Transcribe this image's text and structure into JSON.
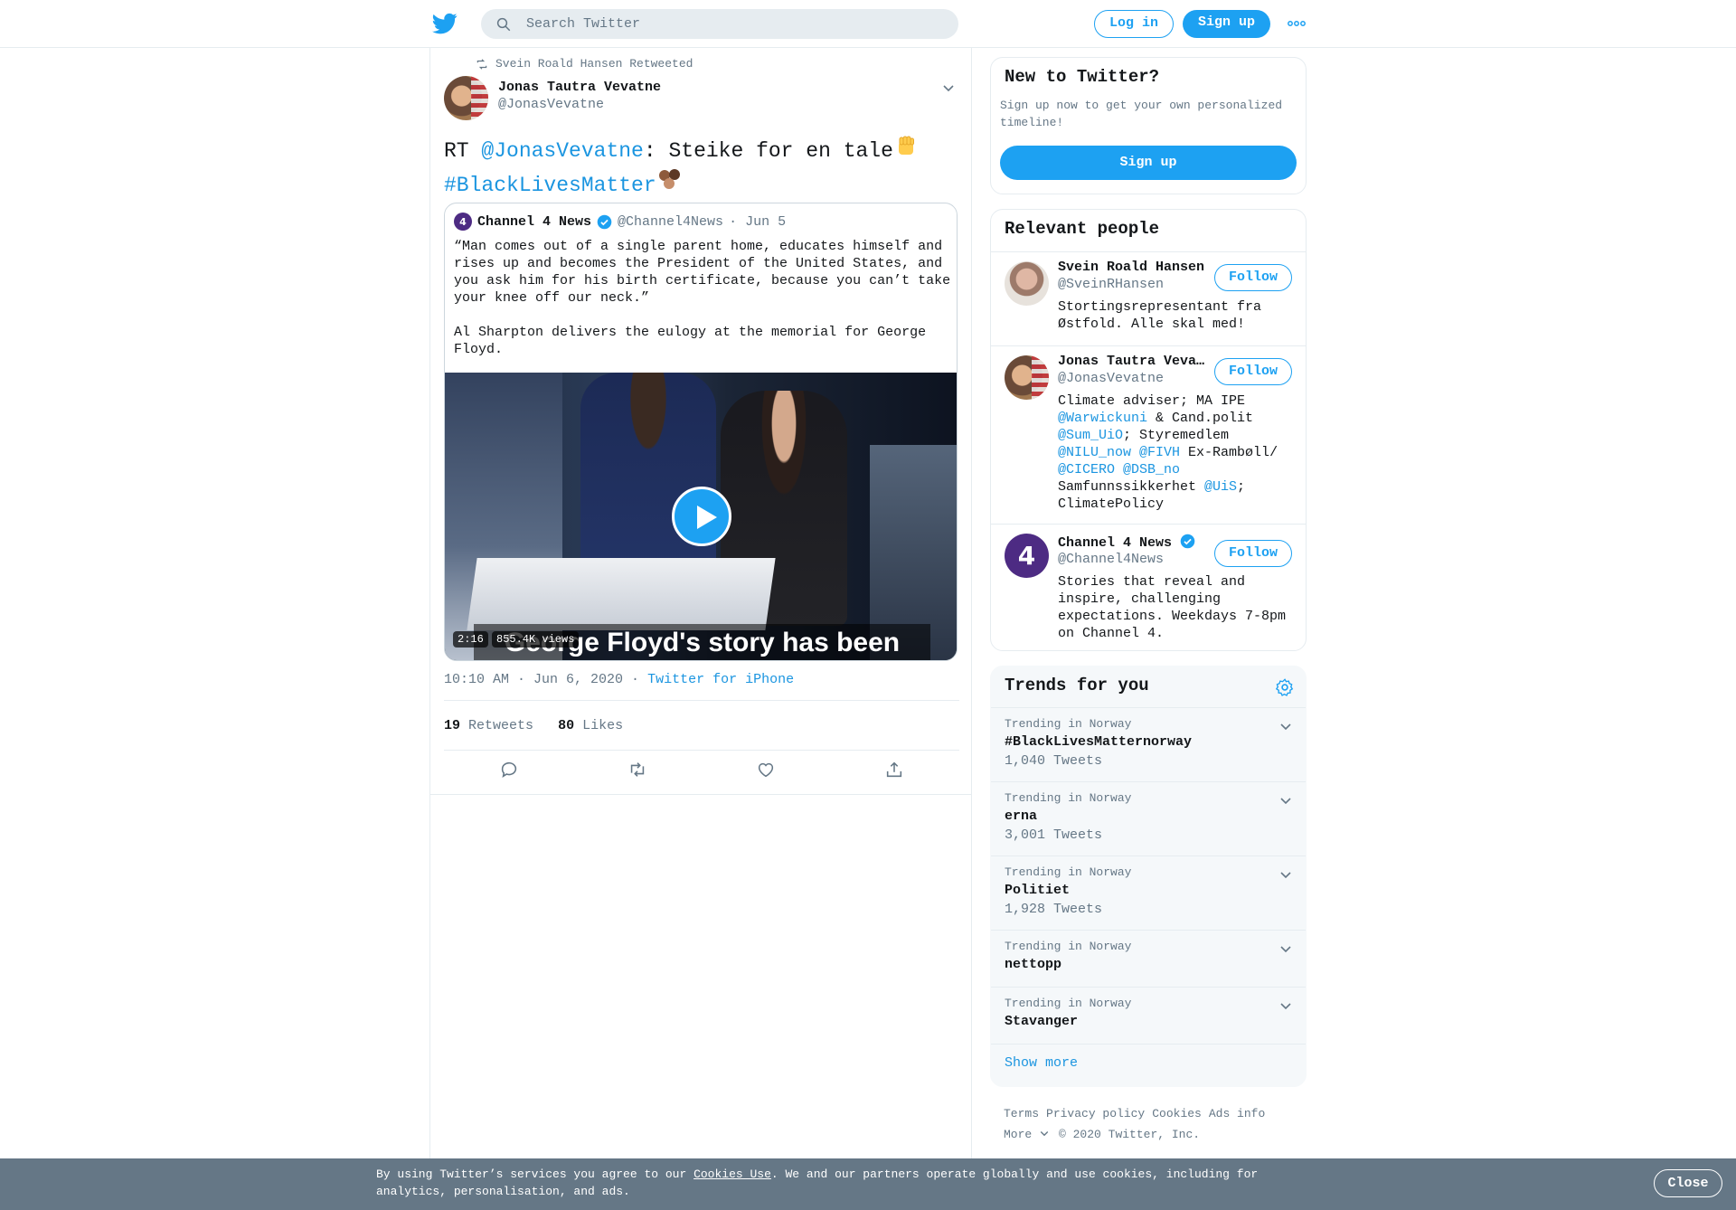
{
  "header": {
    "search_placeholder": "Search Twitter",
    "login_label": "Log in",
    "signup_label": "Sign up"
  },
  "tweet": {
    "retweeted_by": "Svein Roald Hansen Retweeted",
    "author_name": "Jonas Tautra Vevatne",
    "author_handle": "@JonasVevatne",
    "text_prefix": "RT ",
    "text_mention": "@JonasVevatne",
    "text_body": ": Steike for en tale",
    "text_hashtag": "#BlackLivesMatter",
    "quoted": {
      "name": "Channel 4 News",
      "handle": "@Channel4News",
      "date": "· Jun 5",
      "text": "“Man comes out of a single parent home, educates himself and rises up and becomes the President of the United States, and you ask him for his birth certificate, because you can’t take your knee off our neck.”\n\nAl Sharpton delivers the eulogy at the memorial for George Floyd.",
      "video_caption": "George Floyd's story has been",
      "duration": "2:16",
      "views": "855.4K views"
    },
    "timestamp": "10:10 AM · Jun 6, 2020 ·",
    "source": "Twitter for iPhone",
    "retweets_count": "19",
    "retweets_label": "Retweets",
    "likes_count": "80",
    "likes_label": "Likes"
  },
  "sidebar": {
    "new_card": {
      "title": "New to Twitter?",
      "text": "Sign up now to get your own personalized timeline!",
      "button": "Sign up"
    },
    "people_title": "Relevant people",
    "follow_label": "Follow",
    "people": [
      {
        "name": "Svein Roald Hansen",
        "handle": "@SveinRHansen",
        "bio": "Stortingsrepresentant fra Østfold. Alle skal med!"
      },
      {
        "name": "Jonas Tautra Vevatne",
        "handle": "@JonasVevatne",
        "bio_parts": [
          "Climate adviser; MA IPE ",
          "@Warwickuni",
          " & Cand.polit ",
          "@Sum_UiO",
          "; Styremedlem ",
          "@NILU_now",
          " ",
          "@FIVH",
          " Ex-Rambøll/ ",
          "@CICERO",
          " ",
          "@DSB_no",
          " Samfunnssikkerhet ",
          "@UiS",
          "; ClimatePolicy"
        ]
      },
      {
        "name": "Channel 4 News",
        "handle": "@Channel4News",
        "bio": "Stories that reveal and inspire, challenging expectations. Weekdays 7-8pm on Channel 4."
      }
    ],
    "trends_title": "Trends for you",
    "trends": [
      {
        "context": "Trending in Norway",
        "name": "#BlackLivesMatternorway",
        "count": "1,040 Tweets"
      },
      {
        "context": "Trending in Norway",
        "name": "erna",
        "count": "3,001 Tweets"
      },
      {
        "context": "Trending in Norway",
        "name": "Politiet",
        "count": "1,928 Tweets"
      },
      {
        "context": "Trending in Norway",
        "name": "nettopp",
        "count": ""
      },
      {
        "context": "Trending in Norway",
        "name": "Stavanger",
        "count": ""
      }
    ],
    "show_more": "Show more",
    "footer": {
      "links": [
        "Terms",
        "Privacy policy",
        "Cookies",
        "Ads info"
      ],
      "more": "More",
      "copyright": "© 2020 Twitter, Inc."
    }
  },
  "cookie_bar": {
    "text_before": "By using Twitter’s services you agree to our ",
    "link": "Cookies Use",
    "text_after": ". We and our partners operate globally and use cookies, including for analytics, personalisation, and ads.",
    "close": "Close"
  },
  "colors": {
    "brand_blue": "#1da1f2",
    "link_blue": "#1b95e0",
    "secondary_text": "#657786",
    "border": "#e6ecf0",
    "cookie_bg": "#657786"
  }
}
